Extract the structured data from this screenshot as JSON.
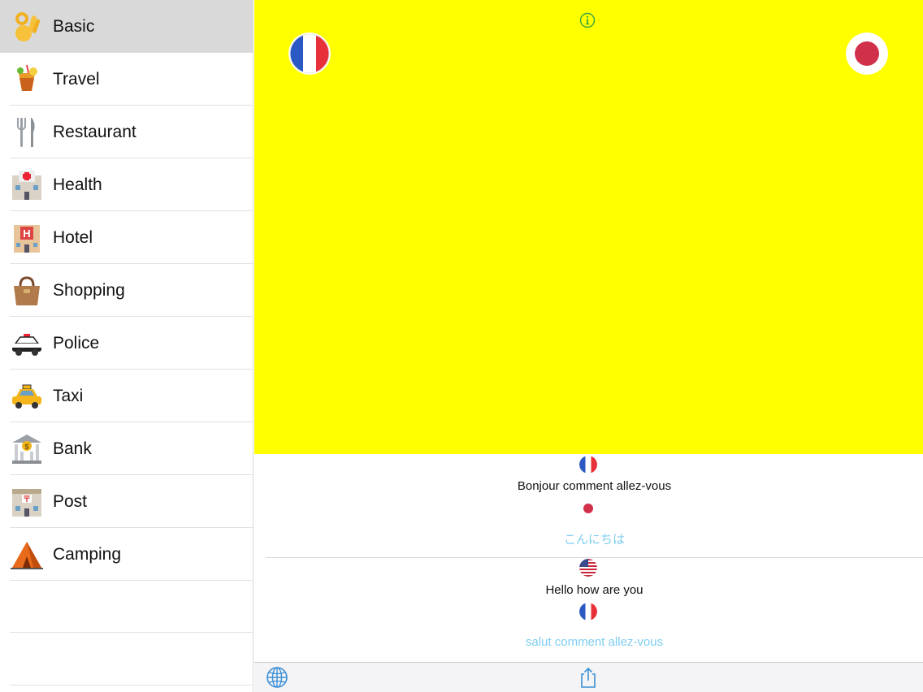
{
  "sidebar": {
    "items": [
      {
        "label": "Basic",
        "icon": "ok-hand-icon"
      },
      {
        "label": "Travel",
        "icon": "tropical-drink-icon"
      },
      {
        "label": "Restaurant",
        "icon": "fork-and-knife-icon"
      },
      {
        "label": "Health",
        "icon": "hospital-icon"
      },
      {
        "label": "Hotel",
        "icon": "hotel-icon"
      },
      {
        "label": "Shopping",
        "icon": "handbag-icon"
      },
      {
        "label": "Police",
        "icon": "police-car-icon"
      },
      {
        "label": "Taxi",
        "icon": "taxi-icon"
      },
      {
        "label": "Bank",
        "icon": "bank-icon"
      },
      {
        "label": "Post",
        "icon": "post-office-icon"
      },
      {
        "label": "Camping",
        "icon": "tent-icon"
      }
    ],
    "selected": "Basic"
  },
  "main": {
    "background": "#ffff00",
    "left_language_flag": "france-flag-icon",
    "right_language_flag": "japan-flag-icon"
  },
  "phrases": [
    {
      "source_flag": "france-flag-icon",
      "source_text": "Bonjour comment allez-vous",
      "target_flag": "japan-flag-icon",
      "translation": "こんにちは"
    },
    {
      "source_flag": "usa-flag-icon",
      "source_text": "Hello how are you",
      "target_flag": "france-flag-icon",
      "translation": "salut comment allez-vous"
    }
  ],
  "colors": {
    "accent": "#3b8fd6",
    "translation": "#7fcdf0",
    "selected_row": "#d9d9d9"
  }
}
